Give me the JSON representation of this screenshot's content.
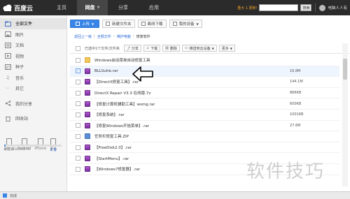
{
  "topbar": {
    "logo": "百度云",
    "tabs": [
      {
        "label": "主页"
      },
      {
        "label": "网盘",
        "active": true
      },
      {
        "label": "分享"
      },
      {
        "label": "应用"
      }
    ],
    "notice": "重大 1 更新!",
    "search_button": "搜索",
    "user": "电脑人人有"
  },
  "sidebar": {
    "items": [
      {
        "label": "全部文件",
        "icon": "folder-icon",
        "active": true
      },
      {
        "label": "图片",
        "icon": "image-icon"
      },
      {
        "label": "文档",
        "icon": "document-icon"
      },
      {
        "label": "视频",
        "icon": "video-icon"
      },
      {
        "label": "种子",
        "icon": "torrent-icon"
      },
      {
        "label": "音乐",
        "icon": "music-icon"
      },
      {
        "label": "其它",
        "icon": "other-icon"
      }
    ],
    "share": {
      "label": "我的分享",
      "icon": "share-icon"
    },
    "recycle": {
      "label": "回收站",
      "icon": "trash-icon"
    },
    "devices": [
      {
        "label": "云管家"
      },
      {
        "label": "Android"
      },
      {
        "label": "iPhone"
      },
      {
        "label": "更多"
      }
    ],
    "quota": {
      "text": "45Y, 42G/2057G",
      "link": "扩容",
      "fraction": 0.02
    }
  },
  "toolbar": {
    "upload": "上传",
    "new_folder": "新建文件夹",
    "offline": "离线下载",
    "devices": "我的设备"
  },
  "breadcrumb": {
    "back": "返回上一级",
    "root": "全部文件",
    "level1": "维护电脑",
    "current": "修复软件"
  },
  "selection": {
    "text": "已选中1个文件/文件夹",
    "share": "分享",
    "download": "下载",
    "delete": "删除",
    "push": "推送到云设备",
    "more": "更多"
  },
  "files": [
    {
      "name": "Windows启动菜单自动修复工具",
      "type": "folder",
      "size": "",
      "date": ""
    },
    {
      "name": "BLLSuite.rar",
      "type": "rar",
      "size": "16.8M",
      "date": "",
      "selected": true
    },
    {
      "name": "【DirectX修复工具】.rar",
      "type": "rar",
      "size": "144.1M",
      "date": ""
    },
    {
      "name": "DirectX Repair V3.3 在线版.7z",
      "type": "rar",
      "size": "866KB",
      "date": ""
    },
    {
      "name": "【修复计算机辅助工具】wsmg.rar",
      "type": "rar",
      "size": "600KB",
      "date": ""
    },
    {
      "name": "【修复系统】.rar",
      "type": "rar",
      "size": "1001KB",
      "date": ""
    },
    {
      "name": "【修复Windows开始菜单】.rar",
      "type": "rar",
      "size": "27.6M",
      "date": ""
    },
    {
      "name": "任务栏修复工具.ZIP",
      "type": "exe",
      "size": "",
      "date": ""
    },
    {
      "name": "【FreeDisk2.0】.rar",
      "type": "rar",
      "size": "",
      "date": ""
    },
    {
      "name": "【StartMenu】.rar",
      "type": "rar",
      "size": "",
      "date": ""
    },
    {
      "name": "【Windows7修复器】.rar",
      "type": "rar",
      "size": "",
      "date": ""
    }
  ],
  "status": {
    "text": "完成"
  },
  "watermark": "软件技巧"
}
